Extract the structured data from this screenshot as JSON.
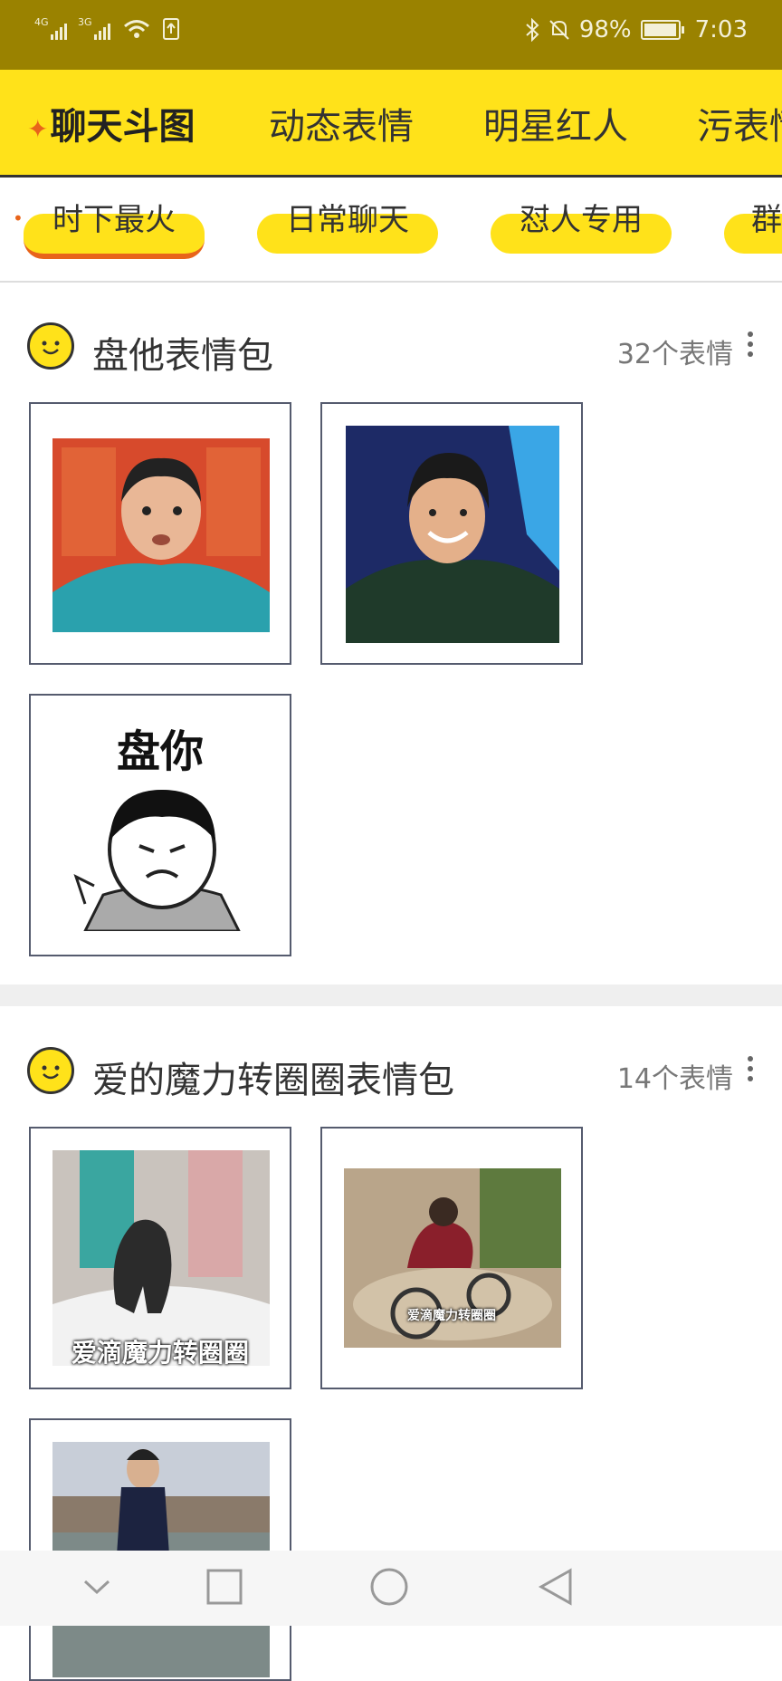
{
  "status_bar": {
    "network_1": "4G",
    "network_2": "3G",
    "battery_percent": "98%",
    "battery_level": 0.98,
    "time": "7:03"
  },
  "top_tabs": [
    "聊天斗图",
    "动态表情",
    "明星红人",
    "污表情"
  ],
  "active_top_tab": 0,
  "sub_tabs": [
    "时下最火",
    "日常聊天",
    "怼人专用",
    "群"
  ],
  "active_sub_tab": 0,
  "sections": [
    {
      "title": "盘他表情包",
      "count": "32个表情",
      "items": [
        {
          "icon": "meme-image",
          "caption": ""
        },
        {
          "icon": "meme-image",
          "caption": ""
        },
        {
          "icon": "meme-image",
          "caption": "盘你"
        }
      ]
    },
    {
      "title": "爱的魔力转圈圈表情包",
      "count": "14个表情",
      "items": [
        {
          "icon": "meme-image",
          "caption": "爱滴魔力转圈圈"
        },
        {
          "icon": "meme-image",
          "caption": "爱滴魔力转圈圈"
        },
        {
          "icon": "meme-image",
          "caption": ""
        }
      ]
    }
  ],
  "colors": {
    "status_bar": "#9a8200",
    "accent_yellow": "#ffe21a",
    "accent_orange": "#e8641a"
  },
  "nav_icons": [
    "chevron-down-icon",
    "square-icon",
    "circle-icon",
    "back-triangle-icon"
  ]
}
